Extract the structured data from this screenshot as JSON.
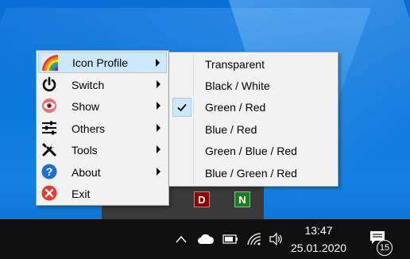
{
  "menu": {
    "items": [
      {
        "label": "Icon Profile",
        "icon": "rainbow-icon",
        "has_submenu": true
      },
      {
        "label": "Switch",
        "icon": "power-icon",
        "has_submenu": true
      },
      {
        "label": "Show",
        "icon": "eye-icon",
        "has_submenu": true
      },
      {
        "label": "Others",
        "icon": "sliders-icon",
        "has_submenu": true
      },
      {
        "label": "Tools",
        "icon": "tools-icon",
        "has_submenu": true
      },
      {
        "label": "About",
        "icon": "help-icon",
        "has_submenu": true
      },
      {
        "label": "Exit",
        "icon": "close-icon",
        "has_submenu": false
      }
    ]
  },
  "submenu": {
    "items": [
      {
        "label": "Transparent",
        "checked": false
      },
      {
        "label": "Black / White",
        "checked": false
      },
      {
        "label": "Green / Red",
        "checked": true
      },
      {
        "label": "Blue / Red",
        "checked": false
      },
      {
        "label": "Green / Blue / Red",
        "checked": false
      },
      {
        "label": "Blue / Green / Red",
        "checked": false
      }
    ]
  },
  "tray_flyout": {
    "badges": [
      "D",
      "N"
    ]
  },
  "taskbar": {
    "time": "13:47",
    "date": "25.01.2020",
    "notification_count": "15"
  },
  "colors": {
    "menu_highlight": "#cce8ff",
    "badge_d": "#8b0000",
    "badge_n": "#1c7a22"
  }
}
